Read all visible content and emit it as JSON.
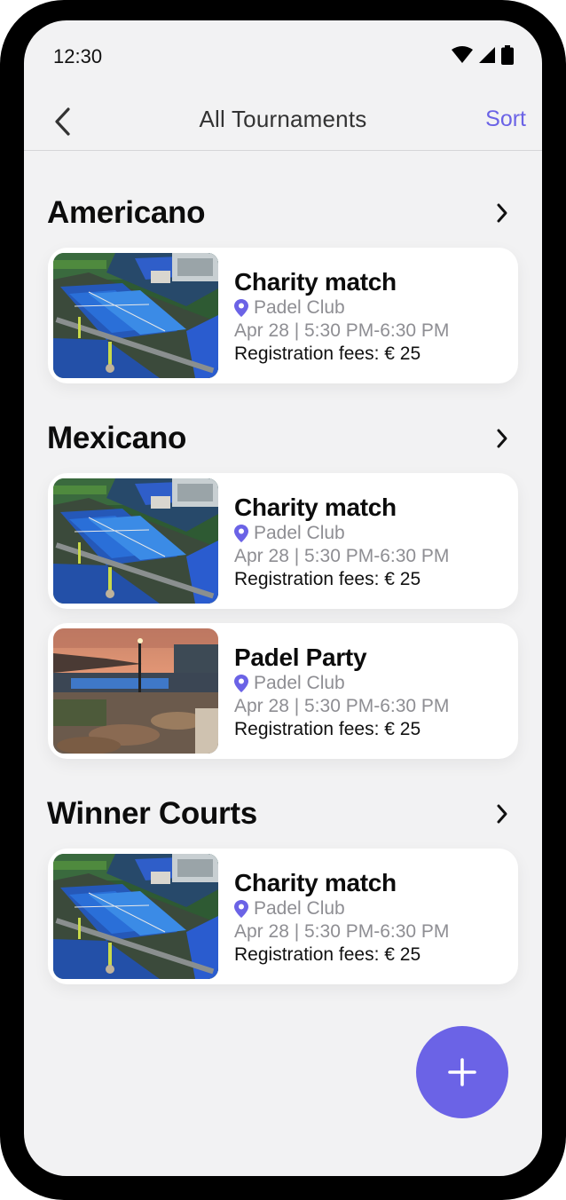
{
  "status_bar": {
    "time": "12:30"
  },
  "nav": {
    "title": "All Tournaments",
    "sort_label": "Sort"
  },
  "sections": [
    {
      "title": "Americano",
      "cards": [
        {
          "title": "Charity match",
          "location": "Padel Club",
          "date": "Apr 28 | 5:30 PM-6:30 PM",
          "fee": "Registration fees: € 25",
          "image": "padel-courts-aerial"
        }
      ]
    },
    {
      "title": "Mexicano",
      "cards": [
        {
          "title": "Charity match",
          "location": "Padel Club",
          "date": "Apr 28 | 5:30 PM-6:30 PM",
          "fee": "Registration fees: € 25",
          "image": "padel-courts-aerial"
        },
        {
          "title": "Padel Party",
          "location": "Padel Club",
          "date": "Apr 28 | 5:30 PM-6:30 PM",
          "fee": "Registration fees: € 25",
          "image": "padel-terrace-sunset"
        }
      ]
    },
    {
      "title": "Winner Courts",
      "cards": [
        {
          "title": "Charity match",
          "location": "Padel Club",
          "date": "Apr 28 | 5:30 PM-6:30 PM",
          "fee": "Registration fees: € 25",
          "image": "padel-courts-aerial"
        }
      ]
    }
  ],
  "colors": {
    "accent": "#6b63e6",
    "background": "#f2f2f3",
    "card": "#ffffff"
  },
  "icons": [
    "back-chevron-icon",
    "chevron-right-icon",
    "location-pin-icon",
    "plus-icon",
    "wifi-icon",
    "signal-icon",
    "battery-icon"
  ]
}
